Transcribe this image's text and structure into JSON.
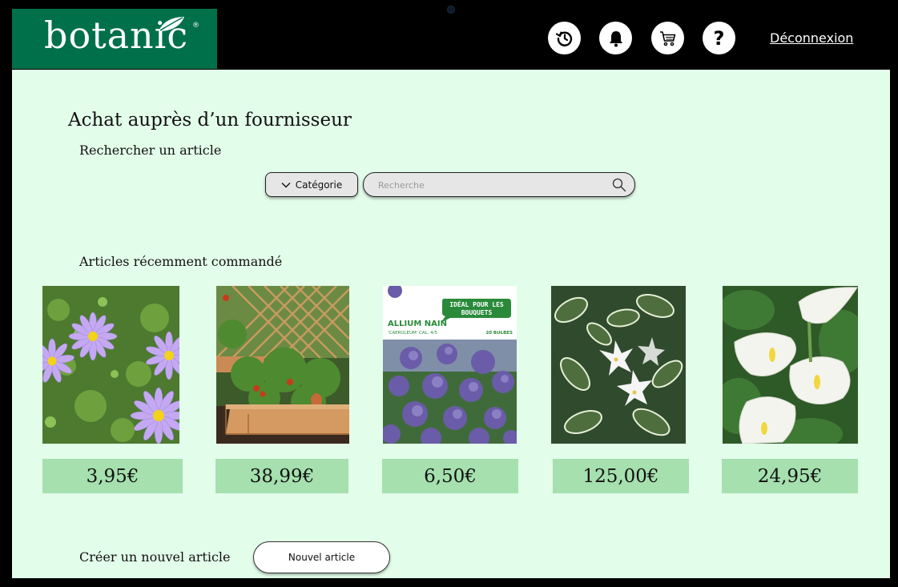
{
  "brand": {
    "name": "botanic",
    "reg_mark": "®"
  },
  "header": {
    "icons": [
      "history-icon",
      "bell-icon",
      "cart-icon",
      "help-icon"
    ],
    "help_glyph": "?",
    "logout_label": "Déconnexion"
  },
  "main": {
    "title": "Achat auprès d’un fournisseur",
    "search_section": {
      "label": "Rechercher un article",
      "category_label": "Catégorie",
      "search_placeholder": "Recherche"
    },
    "recent_section": {
      "label": "Articles récemment commandé",
      "products": [
        {
          "image": "purple-daisy-flowers",
          "price": "3,95€"
        },
        {
          "image": "raised-garden-bed",
          "price": "38,99€"
        },
        {
          "image": "allium-bulb-packet",
          "price": "6,50€",
          "packet_title": "ALLIUM NAIN",
          "packet_subtitle": "'CAERULEUM' CAL. 4/5",
          "packet_count": "20 BULBES",
          "packet_bubble_line1": "IDÉAL POUR LES",
          "packet_bubble_line2": "BOUQUETS"
        },
        {
          "image": "white-flowered-shrub",
          "price": "125,00€"
        },
        {
          "image": "white-calla-lilies",
          "price": "24,95€"
        }
      ]
    },
    "create_section": {
      "label": "Créer un nouvel article",
      "button_label": "Nouvel article"
    }
  },
  "colors": {
    "brand_green": "#00704a",
    "page_bg": "#e2fde9",
    "price_bg": "#a5e0ae",
    "frame": "#000000"
  }
}
